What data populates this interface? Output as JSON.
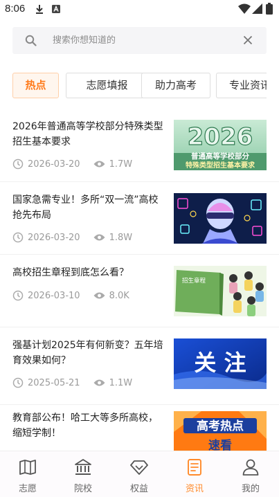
{
  "status_bar": {
    "time": "8:06"
  },
  "search": {
    "placeholder": "搜索你想知道的"
  },
  "tabs": [
    {
      "label": "热点",
      "active": true
    },
    {
      "label": "志愿填报",
      "active": false
    },
    {
      "label": "助力高考",
      "active": false
    },
    {
      "label": "专业资讯",
      "active": false
    }
  ],
  "news": [
    {
      "title": "2026年普通高等学校部分特殊类型招生基本要求",
      "date": "2026-03-20",
      "views": "1.7W",
      "thumb": {
        "big": "2026",
        "line1": "普通高等学校部分",
        "line2": "特殊类型招生基本要求"
      }
    },
    {
      "title": "国家急需专业！多所“双一流”高校抢先布局",
      "date": "2026-03-20",
      "views": "1.8W",
      "thumb": {
        "type": "ai-robot"
      }
    },
    {
      "title": "高校招生章程到底怎么看？",
      "date": "2026-03-10",
      "views": "8.0K",
      "thumb": {
        "book_label": "招生章程"
      }
    },
    {
      "title": "强基计划2025年有何新变？五年培育效果如何？",
      "date": "2025-05-21",
      "views": "1.1W",
      "thumb": {
        "text": "关 注"
      }
    },
    {
      "title": "教育部公布！哈工大等多所高校，缩短学制！",
      "date": "",
      "views": "",
      "thumb": {
        "line1": "高考热点",
        "line2": "速看"
      }
    }
  ],
  "bottom_nav": [
    {
      "label": "志愿",
      "icon": "book-map-icon",
      "active": false
    },
    {
      "label": "院校",
      "icon": "university-icon",
      "active": false
    },
    {
      "label": "权益",
      "icon": "diamond-icon",
      "active": false
    },
    {
      "label": "资讯",
      "icon": "news-doc-icon",
      "active": true
    },
    {
      "label": "我的",
      "icon": "user-icon",
      "active": false
    }
  ],
  "colors": {
    "accent": "#ff7a1a",
    "accent_light": "#fff6ee",
    "meta_gray": "#9a9a9a"
  }
}
